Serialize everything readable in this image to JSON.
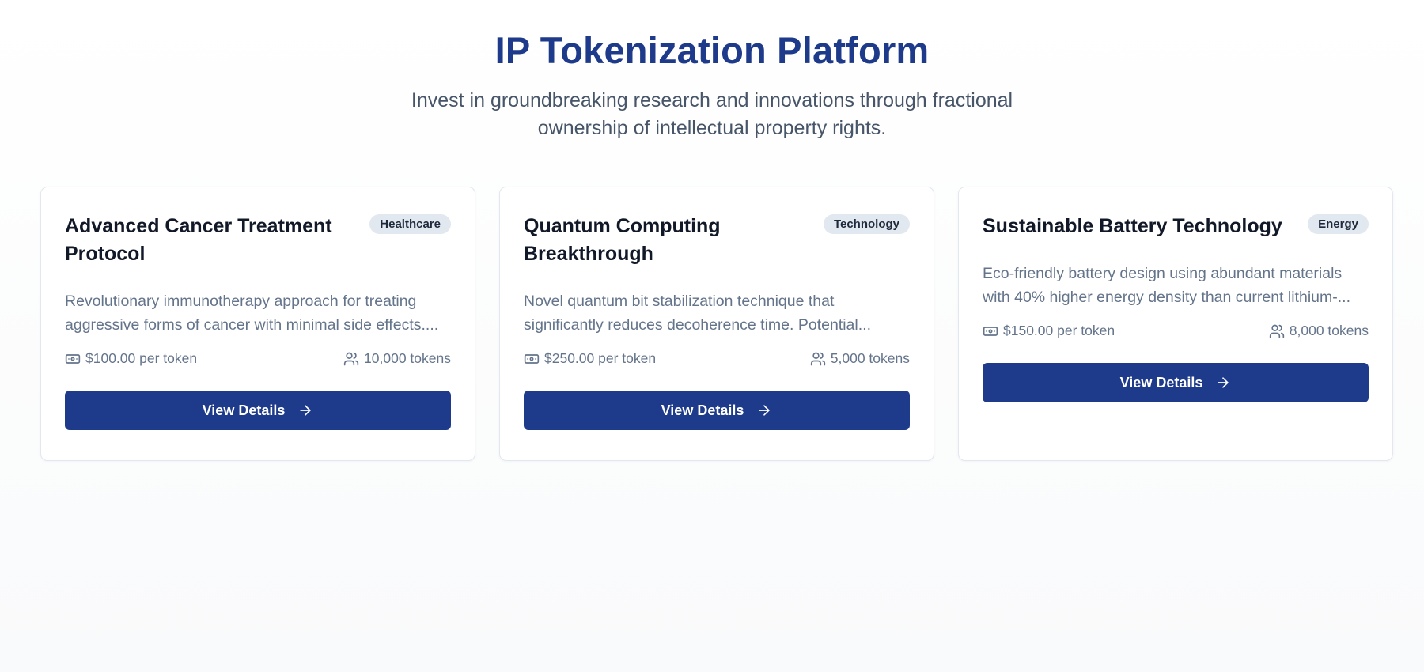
{
  "header": {
    "title": "IP Tokenization Platform",
    "subtitle": "Invest in groundbreaking research and innovations through fractional ownership of intellectual property rights."
  },
  "colors": {
    "brand": "#1e3a8a",
    "badge_bg": "#e2e8f0",
    "muted_text": "#64748b"
  },
  "cards": [
    {
      "title": "Advanced Cancer Treatment Protocol",
      "category": "Healthcare",
      "description": "Revolutionary immunotherapy approach for treating aggressive forms of cancer with minimal side effects....",
      "price": "$100.00 per token",
      "supply": "10,000 tokens",
      "button_label": "View Details",
      "price_icon": "banknote-icon",
      "supply_icon": "users-icon",
      "button_icon": "arrow-right-icon"
    },
    {
      "title": "Quantum Computing Breakthrough",
      "category": "Technology",
      "description": "Novel quantum bit stabilization technique that significantly reduces decoherence time. Potential...",
      "price": "$250.00 per token",
      "supply": "5,000 tokens",
      "button_label": "View Details",
      "price_icon": "banknote-icon",
      "supply_icon": "users-icon",
      "button_icon": "arrow-right-icon"
    },
    {
      "title": "Sustainable Battery Technology",
      "category": "Energy",
      "description": "Eco-friendly battery design using abundant materials with 40% higher energy density than current lithium-...",
      "price": "$150.00 per token",
      "supply": "8,000 tokens",
      "button_label": "View Details",
      "price_icon": "banknote-icon",
      "supply_icon": "users-icon",
      "button_icon": "arrow-right-icon"
    }
  ]
}
